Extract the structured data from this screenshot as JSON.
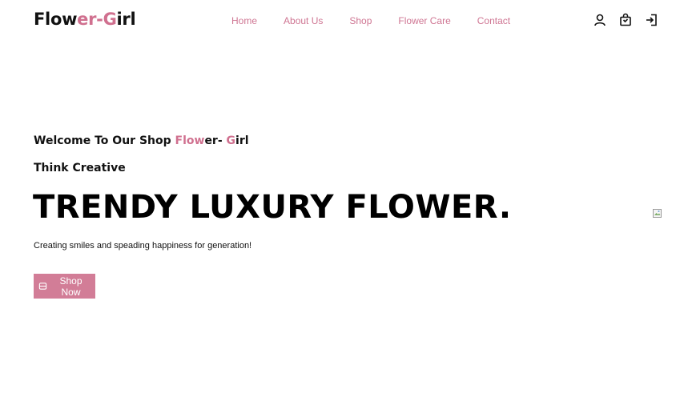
{
  "brand": {
    "logo_part1": "Flow",
    "logo_part2": "er",
    "logo_dash": "-",
    "logo_part3": "G",
    "logo_part4": "irl",
    "accent_color": "#d0708f"
  },
  "nav": {
    "items": [
      "Home",
      "About Us",
      "Shop",
      "Flower Care",
      "Contact"
    ]
  },
  "header_icons": [
    "user-icon",
    "shopping-bag-icon",
    "login-icon"
  ],
  "hero": {
    "welcome_prefix": "Welcome To Our Shop ",
    "welcome_brand_a": "Flow",
    "welcome_brand_b": "er- ",
    "welcome_brand_c": "G",
    "welcome_brand_d": "irl",
    "subheading": "Think Creative",
    "headline": "TRENDY LUXURY FLOWER.",
    "tagline": "Creating smiles and speading happiness for generation!",
    "button_label": "Shop Now",
    "button_color": "#d27d97"
  },
  "hero_image": {
    "state": "broken-image-icon"
  }
}
